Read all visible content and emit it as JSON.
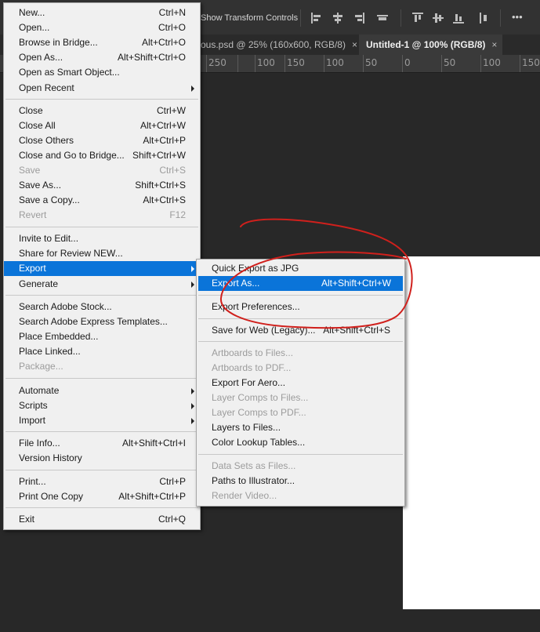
{
  "toolbar": {
    "transform_label": "Show Transform Controls",
    "more_label": "•••"
  },
  "tabs": [
    {
      "label": "ous.psd @ 25% (160x600, RGB/8)",
      "close": "×"
    },
    {
      "label": "Untitled-1 @ 100% (RGB/8)",
      "close": "×"
    }
  ],
  "ruler": [
    "250",
    "100",
    "150",
    "100",
    "50",
    "0",
    "50",
    "100",
    "150"
  ],
  "file_menu": [
    {
      "label": "New...",
      "shortcut": "Ctrl+N"
    },
    {
      "label": "Open...",
      "shortcut": "Ctrl+O"
    },
    {
      "label": "Browse in Bridge...",
      "shortcut": "Alt+Ctrl+O"
    },
    {
      "label": "Open As...",
      "shortcut": "Alt+Shift+Ctrl+O"
    },
    {
      "label": "Open as Smart Object...",
      "shortcut": ""
    },
    {
      "label": "Open Recent",
      "shortcut": ""
    },
    {
      "label": "Close",
      "shortcut": "Ctrl+W"
    },
    {
      "label": "Close All",
      "shortcut": "Alt+Ctrl+W"
    },
    {
      "label": "Close Others",
      "shortcut": "Alt+Ctrl+P"
    },
    {
      "label": "Close and Go to Bridge...",
      "shortcut": "Shift+Ctrl+W"
    },
    {
      "label": "Save",
      "shortcut": "Ctrl+S"
    },
    {
      "label": "Save As...",
      "shortcut": "Shift+Ctrl+S"
    },
    {
      "label": "Save a Copy...",
      "shortcut": "Alt+Ctrl+S"
    },
    {
      "label": "Revert",
      "shortcut": "F12"
    },
    {
      "label": "Invite to Edit...",
      "shortcut": ""
    },
    {
      "label": "Share for Review NEW...",
      "shortcut": ""
    },
    {
      "label": "Export",
      "shortcut": ""
    },
    {
      "label": "Generate",
      "shortcut": ""
    },
    {
      "label": "Search Adobe Stock...",
      "shortcut": ""
    },
    {
      "label": "Search Adobe Express Templates...",
      "shortcut": ""
    },
    {
      "label": "Place Embedded...",
      "shortcut": ""
    },
    {
      "label": "Place Linked...",
      "shortcut": ""
    },
    {
      "label": "Package...",
      "shortcut": ""
    },
    {
      "label": "Automate",
      "shortcut": ""
    },
    {
      "label": "Scripts",
      "shortcut": ""
    },
    {
      "label": "Import",
      "shortcut": ""
    },
    {
      "label": "File Info...",
      "shortcut": "Alt+Shift+Ctrl+I"
    },
    {
      "label": "Version History",
      "shortcut": ""
    },
    {
      "label": "Print...",
      "shortcut": "Ctrl+P"
    },
    {
      "label": "Print One Copy",
      "shortcut": "Alt+Shift+Ctrl+P"
    },
    {
      "label": "Exit",
      "shortcut": "Ctrl+Q"
    }
  ],
  "export_menu": [
    {
      "label": "Quick Export as JPG",
      "shortcut": ""
    },
    {
      "label": "Export As...",
      "shortcut": "Alt+Shift+Ctrl+W"
    },
    {
      "label": "Export Preferences...",
      "shortcut": ""
    },
    {
      "label": "Save for Web (Legacy)...",
      "shortcut": "Alt+Shift+Ctrl+S"
    },
    {
      "label": "Artboards to Files...",
      "shortcut": ""
    },
    {
      "label": "Artboards to PDF...",
      "shortcut": ""
    },
    {
      "label": "Export For Aero...",
      "shortcut": ""
    },
    {
      "label": "Layer Comps to Files...",
      "shortcut": ""
    },
    {
      "label": "Layer Comps to PDF...",
      "shortcut": ""
    },
    {
      "label": "Layers to Files...",
      "shortcut": ""
    },
    {
      "label": "Color Lookup Tables...",
      "shortcut": ""
    },
    {
      "label": "Data Sets as Files...",
      "shortcut": ""
    },
    {
      "label": "Paths to Illustrator...",
      "shortcut": ""
    },
    {
      "label": "Render Video...",
      "shortcut": ""
    }
  ],
  "colors": {
    "highlight": "#0a74d9",
    "menu_bg": "#f0f0f0",
    "disabled_text": "#9c9c9c",
    "annotation": "#d0201c",
    "workspace": "#282828"
  },
  "state": {
    "active_menu_item": "Export",
    "hover_submenu_item": "Export As...",
    "circled_item": "Export As..."
  }
}
